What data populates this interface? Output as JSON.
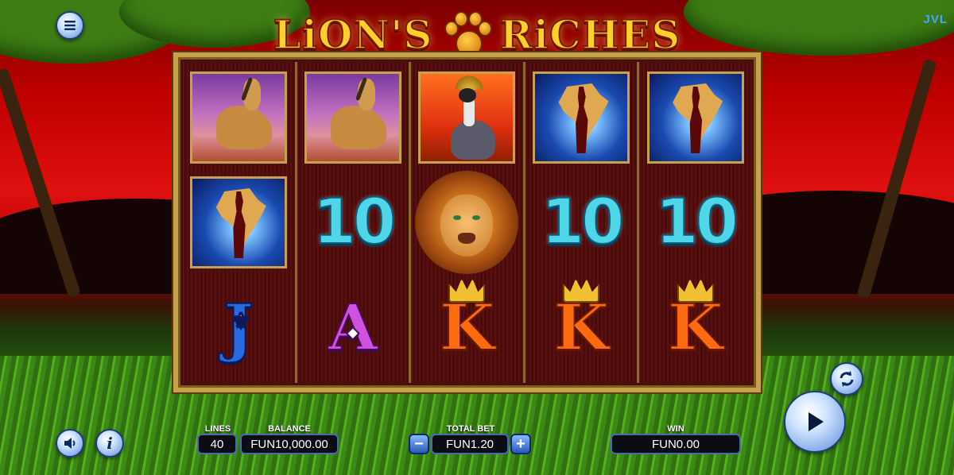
{
  "game": {
    "title": "LiON'S RiCHES",
    "title_part1": "LiON'S",
    "title_part2": "RiCHES",
    "provider": "JVL"
  },
  "reels": [
    [
      "antelope",
      "africa-woman",
      "J"
    ],
    [
      "antelope",
      "10",
      "A"
    ],
    [
      "crowned-crane",
      "lion-wild",
      "K"
    ],
    [
      "africa-woman",
      "10",
      "K"
    ],
    [
      "africa-woman",
      "10",
      "K"
    ]
  ],
  "symbol_text": {
    "ten": "10",
    "j": "J",
    "a": "A",
    "k": "K"
  },
  "hud": {
    "lines_label": "LINES",
    "lines_value": "40",
    "balance_label": "BALANCE",
    "balance_value": "FUN10,000.00",
    "total_bet_label": "TOTAL BET",
    "total_bet_value": "FUN1.20",
    "win_label": "WIN",
    "win_value": "FUN0.00",
    "minus_label": "−",
    "plus_label": "+"
  },
  "icons": {
    "menu": "hamburger-menu-icon",
    "sound": "speaker-icon",
    "info": "info-icon",
    "autoplay": "circular-arrows-icon",
    "spin": "play-triangle-icon"
  },
  "colors": {
    "sky_red": "#e01010",
    "frame_gold": "#c8a24a",
    "hud_border": "#4a6ab0",
    "ten_cyan": "#4fd6e8"
  }
}
